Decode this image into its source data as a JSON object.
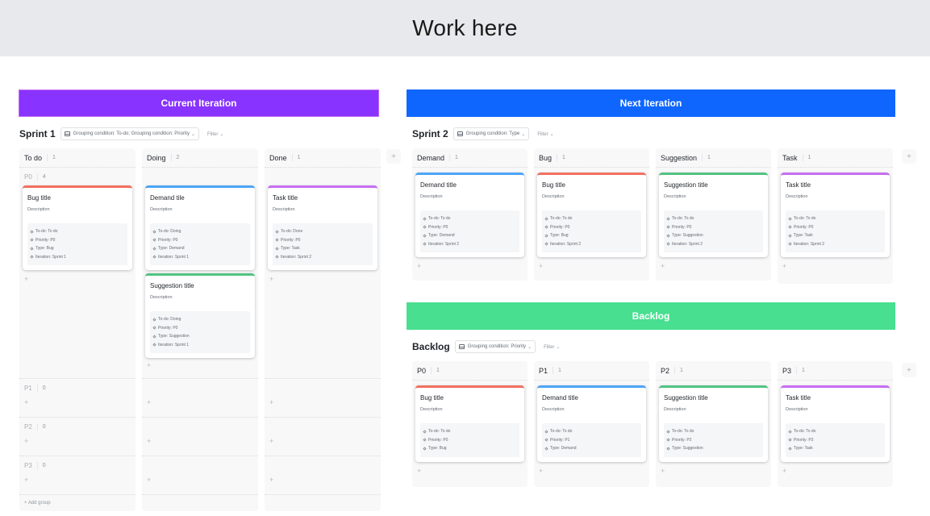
{
  "page_title": "Work here",
  "banners": {
    "current": "Current Iteration",
    "next": "Next Iteration",
    "backlog": "Backlog"
  },
  "colors": {
    "current_banner": "#8833ff",
    "next_banner": "#0f66ff",
    "backlog_banner": "#48df90",
    "bug": "#f2705f",
    "demand": "#4ea5f7",
    "suggestion": "#52c383",
    "task": "#c86ef0"
  },
  "sprint1": {
    "title": "Sprint 1",
    "grouping": "Grouping condition: To-do; Grouping condition: Priority",
    "filter": "Filter",
    "add_group": "+ Add group",
    "columns": [
      {
        "name": "To do",
        "count": "1"
      },
      {
        "name": "Doing",
        "count": "2"
      },
      {
        "name": "Done",
        "count": "1"
      }
    ],
    "sub_groups": [
      {
        "name": "P0",
        "count": "4"
      },
      {
        "name": "P1",
        "count": "0"
      },
      {
        "name": "P2",
        "count": "0"
      },
      {
        "name": "P3",
        "count": "0"
      }
    ],
    "cards": {
      "todo_p0": {
        "title": "Bug title",
        "desc": "Description",
        "fields": [
          "To-do: To do",
          "Priority: P0",
          "Type: Bug",
          "Iteration: Sprint 1"
        ]
      },
      "doing_p0_a": {
        "title": "Demand tile",
        "desc": "Description",
        "fields": [
          "To-do: Doing",
          "Priority: P0",
          "Type: Demand",
          "Iteration: Sprint 1"
        ]
      },
      "doing_p0_b": {
        "title": "Suggestion title",
        "desc": "Description",
        "fields": [
          "To-do: Doing",
          "Priority: P0",
          "Type: Suggestion",
          "Iteration: Sprint 1"
        ]
      },
      "done_p0": {
        "title": "Task title",
        "desc": "Description",
        "fields": [
          "To-do: Done",
          "Priority: P0",
          "Type: Task",
          "Iteration: Sprint 2"
        ]
      }
    }
  },
  "sprint2": {
    "title": "Sprint 2",
    "grouping": "Grouping condition: Type",
    "filter": "Filter",
    "columns": [
      {
        "name": "Demand",
        "count": "1",
        "card": {
          "title": "Demand title",
          "desc": "Description",
          "fields": [
            "To-do: To do",
            "Priority: P0",
            "Type: Demand",
            "Iteration: Sprint 2"
          ]
        }
      },
      {
        "name": "Bug",
        "count": "1",
        "card": {
          "title": "Bug title",
          "desc": "Description",
          "fields": [
            "To-do: To do",
            "Priority: P0",
            "Type: Bug",
            "Iteration: Sprint 2"
          ]
        }
      },
      {
        "name": "Suggestion",
        "count": "1",
        "card": {
          "title": "Suggestion title",
          "desc": "Description",
          "fields": [
            "To-do: To do",
            "Priority: P0",
            "Type: Suggestion",
            "Iteration: Sprint 2"
          ]
        }
      },
      {
        "name": "Task",
        "count": "1",
        "card": {
          "title": "Task title",
          "desc": "Description",
          "fields": [
            "To-do: To do",
            "Priority: P0",
            "Type: Task",
            "Iteration: Sprint 2"
          ]
        }
      }
    ]
  },
  "backlog": {
    "title": "Backlog",
    "grouping": "Grouping condition: Priority",
    "filter": "Filter",
    "columns": [
      {
        "name": "P0",
        "count": "1",
        "card": {
          "title": "Bug title",
          "desc": "Description",
          "fields": [
            "To-do: To do",
            "Priority: P0",
            "Type: Bug"
          ]
        }
      },
      {
        "name": "P1",
        "count": "1",
        "card": {
          "title": "Demand title",
          "desc": "Description",
          "fields": [
            "To-do: To do",
            "Priority: P1",
            "Type: Demand"
          ]
        }
      },
      {
        "name": "P2",
        "count": "1",
        "card": {
          "title": "Suggestion title",
          "desc": "Description",
          "fields": [
            "To-do: To do",
            "Priority: P2",
            "Type: Suggestion"
          ]
        }
      },
      {
        "name": "P3",
        "count": "1",
        "card": {
          "title": "Task title",
          "desc": "Description",
          "fields": [
            "To-do: To do",
            "Priority: P3",
            "Type: Task"
          ]
        }
      }
    ]
  },
  "icons": {
    "plus": "+",
    "chevron": "⌄",
    "field": "field-diamond-icon",
    "grouping": "grouping-icon"
  }
}
